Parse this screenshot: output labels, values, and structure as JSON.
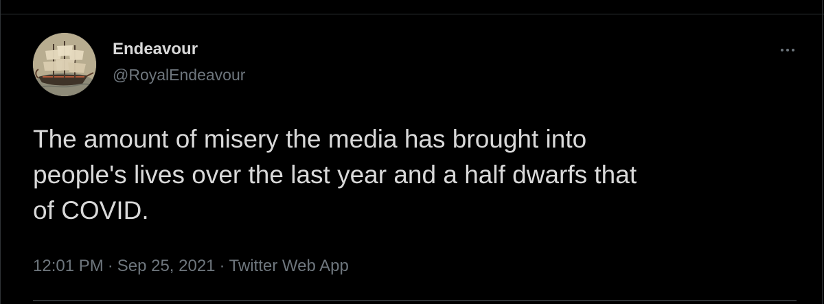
{
  "author": {
    "display_name": "Endeavour",
    "username": "@RoyalEndeavour",
    "avatar_icon": "sailing-ship-avatar"
  },
  "tweet": {
    "text": "The amount of misery the media has brought into\npeople's lives over the last year and a half dwarfs that\nof COVID.",
    "time": "12:01 PM",
    "separator_1": "·",
    "date": "Sep 25, 2021",
    "separator_2": "·",
    "source": "Twitter Web App"
  },
  "colors": {
    "background": "#000000",
    "primary_text": "#d9d9d9",
    "secondary_text": "#6e767d",
    "divider": "#2f3336"
  }
}
